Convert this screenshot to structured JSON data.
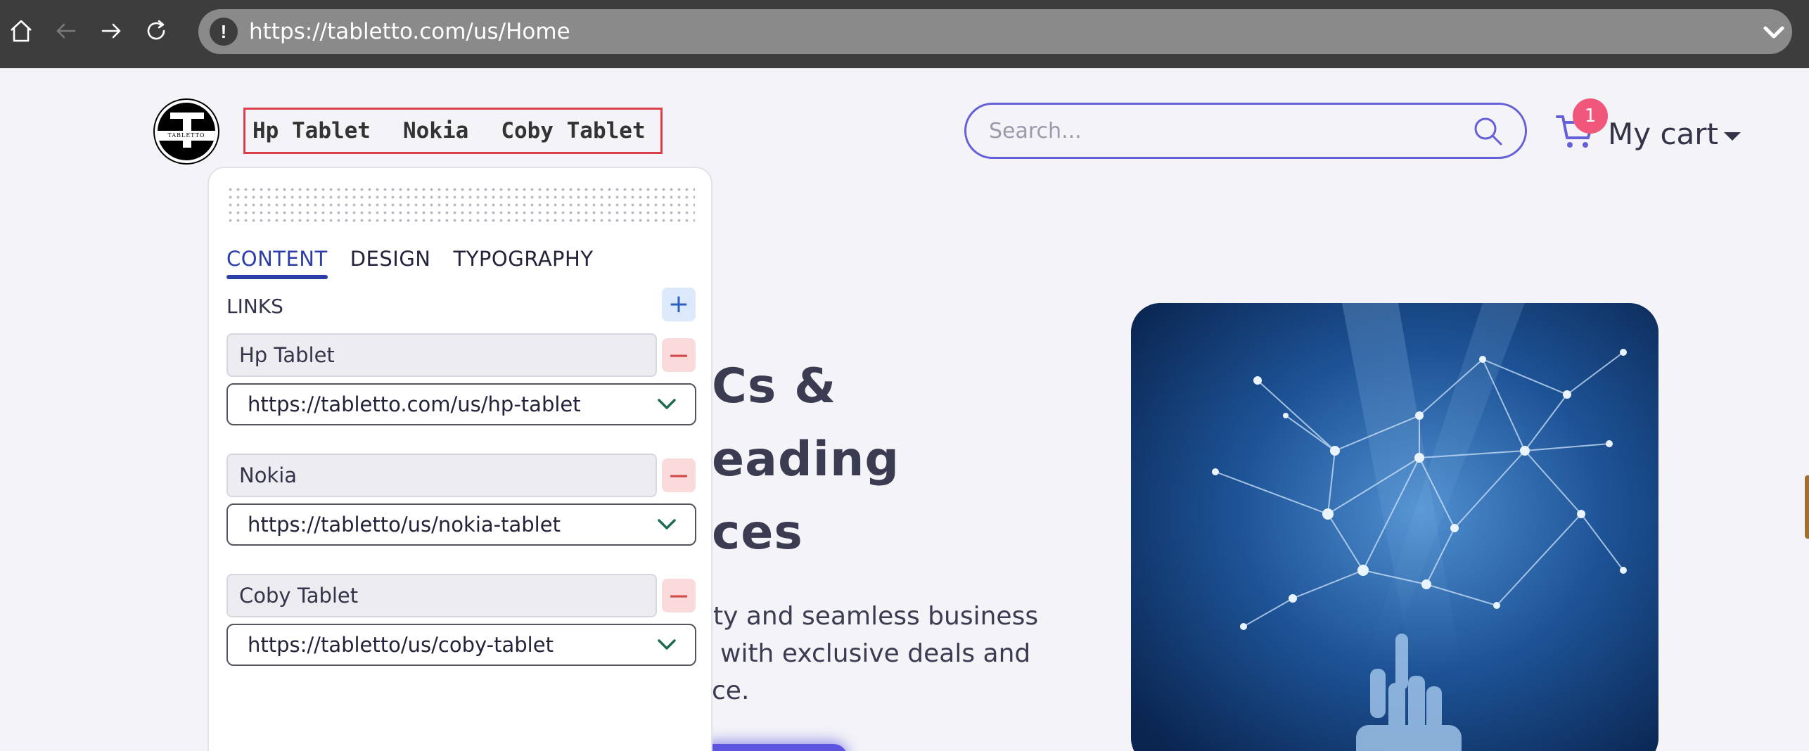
{
  "browser": {
    "url": "https://tabletto.com/us/Home",
    "security_badge": "!"
  },
  "header": {
    "logo_text": "TABLETTO",
    "nav_links": [
      "Hp Tablet",
      "Nokia",
      "Coby Tablet"
    ],
    "search_placeholder": "Search...",
    "cart_count": "1",
    "cart_label": "My cart"
  },
  "hero": {
    "title_lines": [
      "Cs &",
      "eading",
      "ces"
    ],
    "description_lines": [
      "ty and seamless business",
      "with exclusive deals and",
      "ce."
    ]
  },
  "editor_panel": {
    "tabs": [
      "CONTENT",
      "DESIGN",
      "TYPOGRAPHY"
    ],
    "active_tab": "CONTENT",
    "section_label": "LINKS",
    "add_symbol": "+",
    "remove_symbol": "−",
    "links": [
      {
        "name": "Hp Tablet",
        "url": "https://tabletto.com/us/hp-tablet"
      },
      {
        "name": "Nokia",
        "url": "https://tabletto/us/nokia-tablet"
      },
      {
        "name": "Coby Tablet",
        "url": "https://tabletto/us/coby-tablet"
      }
    ]
  },
  "colors": {
    "accent": "#6660d8",
    "badge": "#f0577a",
    "active_tab": "#2b3ea8",
    "nav_highlight_border": "#d9404a"
  },
  "icons": [
    "home-icon",
    "back-arrow-icon",
    "forward-arrow-icon",
    "reload-icon",
    "chevron-down-icon",
    "search-icon",
    "cart-icon",
    "caret-down-icon",
    "plus-icon",
    "minus-icon"
  ]
}
